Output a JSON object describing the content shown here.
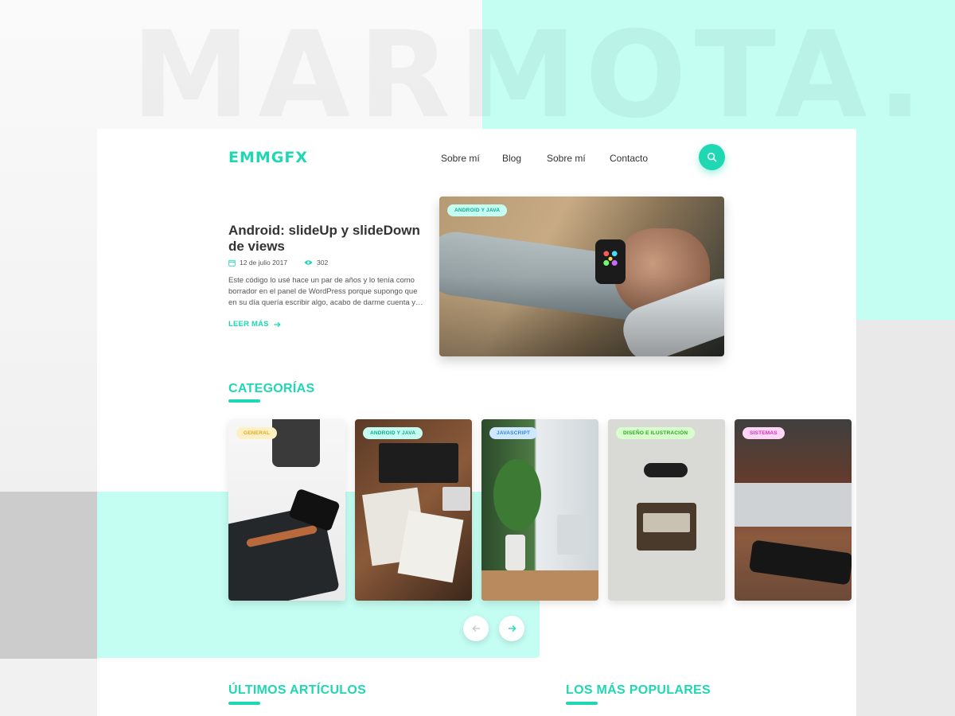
{
  "background_text": "MARMOTA.",
  "header": {
    "logo": "EMMGFX",
    "nav": [
      "Sobre mí",
      "Blog",
      "Sobre mí",
      "Contacto"
    ]
  },
  "hero": {
    "tag": "ANDROID Y JAVA",
    "title": "Android: slideUp y slideDown de views",
    "date": "12 de julio 2017",
    "views": "302",
    "excerpt": "Este código lo usé hace un par de años y lo tenía como borrador en el panel de WordPress porque supongo que en su día quería escribir algo, acabo de darme cuenta y…",
    "read_more": "LEER MÁS"
  },
  "categories": {
    "title": "CATEGORÍAS",
    "items": [
      {
        "label": "GENERAL",
        "tag_bg": "#fff0c4",
        "tag_color": "#e0a92a"
      },
      {
        "label": "ANDROID Y JAVA",
        "tag_bg": "#c4fdf2",
        "tag_color": "#15a98b"
      },
      {
        "label": "JAVASCRIPT",
        "tag_bg": "#cfe7ff",
        "tag_color": "#2f8be0"
      },
      {
        "label": "DISEÑO E ILUSTRACIÓN",
        "tag_bg": "#d6ffcc",
        "tag_color": "#3aa02a"
      },
      {
        "label": "SISTEMAS",
        "tag_bg": "#ffd6f7",
        "tag_color": "#d631b3"
      }
    ]
  },
  "latest": {
    "title": "ÚLTIMOS ARTÍCULOS"
  },
  "popular": {
    "title": "LOS MÁS POPULARES"
  },
  "colors": {
    "accent": "#1fd8b3",
    "mint": "#c4fdf2"
  }
}
